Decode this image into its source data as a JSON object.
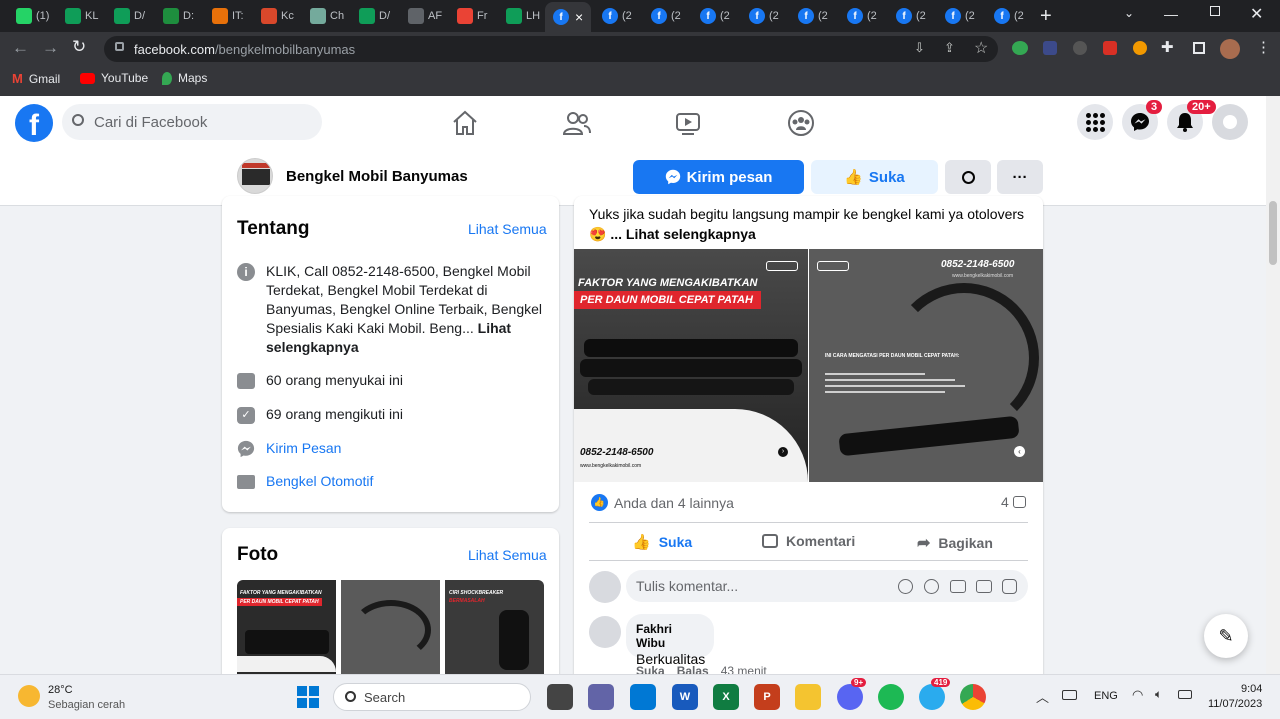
{
  "browser": {
    "tabs": [
      {
        "label": "(1)",
        "color": "#25d366"
      },
      {
        "label": "KL",
        "color": "#0f9d58"
      },
      {
        "label": "D/",
        "color": "#0f9d58"
      },
      {
        "label": "D:",
        "color": "#1e8e3e"
      },
      {
        "label": "IT:",
        "color": "#e8710a"
      },
      {
        "label": "Kc",
        "color": "#d9482b"
      },
      {
        "label": "Ch",
        "color": "#74aa9c"
      },
      {
        "label": "D/",
        "color": "#0f9d58"
      },
      {
        "label": "AF",
        "color": "#5f6368"
      },
      {
        "label": "Fr",
        "color": "#ea4335"
      },
      {
        "label": "LH",
        "color": "#0f9d58"
      }
    ],
    "active_tab_close": "×",
    "fb_tabs": [
      "(2",
      "(2",
      "(2",
      "(2",
      "(2",
      "(2",
      "(2",
      "(2",
      "(2"
    ],
    "new_tab": "+",
    "url_host": "facebook.com",
    "url_path": "/bengkelmobilbanyumas",
    "bookmarks": [
      {
        "label": "Gmail"
      },
      {
        "label": "YouTube"
      },
      {
        "label": "Maps"
      }
    ]
  },
  "fb": {
    "search_placeholder": "Cari di Facebook",
    "messenger_badge": "3",
    "notif_badge": "20+"
  },
  "page": {
    "name": "Bengkel Mobil Banyumas",
    "send_message": "Kirim pesan",
    "like": "Suka",
    "more": "···"
  },
  "about": {
    "title": "Tentang",
    "see_all": "Lihat Semua",
    "description": "KLIK, Call 0852-2148-6500, Bengkel Mobil Terdekat, Bengkel Mobil Terdekat di Banyumas, Bengkel Online Terbaik, Bengkel Spesialis Kaki Kaki Mobil. Beng...",
    "see_more": "Lihat selengkapnya",
    "likes": "60 orang menyukai ini",
    "follows": "69 orang mengikuti ini",
    "message": "Kirim Pesan",
    "category": "Bengkel Otomotif"
  },
  "photos": {
    "title": "Foto",
    "see_all": "Lihat Semua",
    "thumb1_title": "FAKTOR YANG MENGAKIBATKAN",
    "thumb1_sub": "PER DAUN MOBIL CEPAT PATAH",
    "thumb3_title": "CIRI SHOCKBREAKER",
    "thumb3_sub": "BERMASALAH"
  },
  "post": {
    "text": "Yuks jika sudah begitu langsung mampir ke bengkel kami ya otolovers",
    "emoji": "😍",
    "see_more": "... Lihat selengkapnya",
    "img1_title": "FAKTOR YANG MENGAKIBATKAN",
    "img1_sub": "PER DAUN MOBIL CEPAT PATAH",
    "img1_phone": "0852-2148-6500",
    "img1_web": "www.bengkelkakimobil.com",
    "img2_phone": "0852-2148-6500",
    "img2_web": "www.bengkelkakimobil.com",
    "img2_heading": "INI CARA MENGATASI PER DAUN MOBIL CEPAT PATAH:",
    "reactions": "Anda dan 4 lainnya",
    "comment_count": "4",
    "action_like": "Suka",
    "action_comment": "Komentari",
    "action_share": "Bagikan",
    "comment_placeholder": "Tulis komentar...",
    "commenter": "Fakhri Wibu",
    "comment_text": "Berkualitas",
    "comment_like": "Suka",
    "comment_reply": "Balas",
    "comment_time": "43 menit"
  },
  "taskbar": {
    "temp": "28°C",
    "weather": "Sebagian cerah",
    "search": "Search",
    "lang": "ENG",
    "time": "9:04",
    "date": "11/07/2023",
    "discord_badge": "9+",
    "telegram_badge": "419"
  }
}
